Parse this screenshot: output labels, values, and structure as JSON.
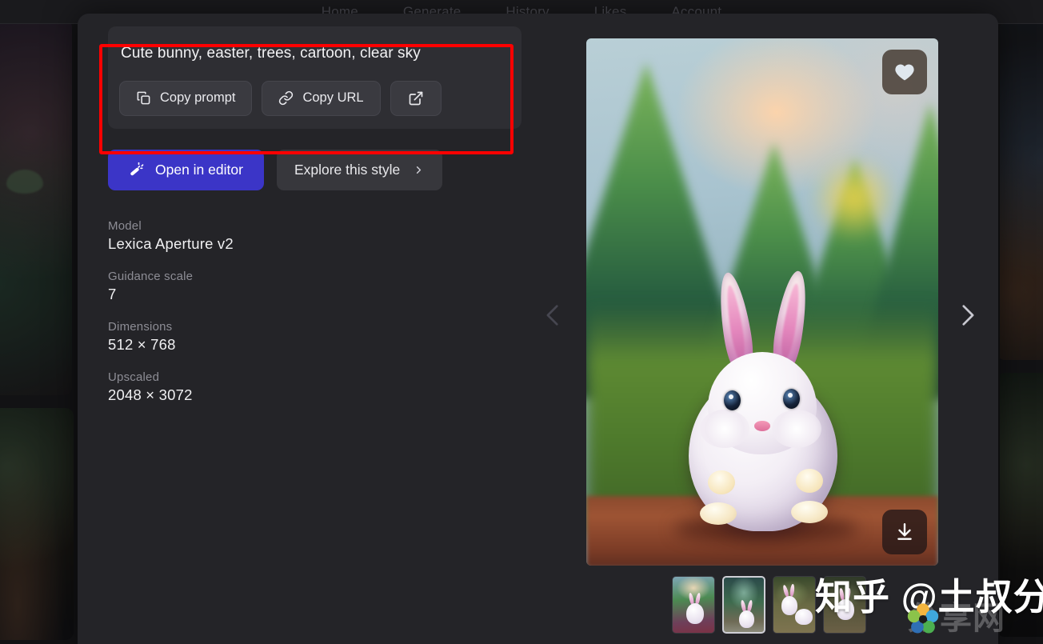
{
  "nav": {
    "items": [
      {
        "label": "Home"
      },
      {
        "label": "Generate"
      },
      {
        "label": "History"
      },
      {
        "label": "Likes"
      },
      {
        "label": "Account"
      }
    ]
  },
  "prompt": {
    "text": "Cute bunny, easter, trees, cartoon, clear sky",
    "copy_prompt_label": "Copy prompt",
    "copy_url_label": "Copy URL",
    "copy_icon": "copy-icon",
    "link_icon": "link-icon",
    "external_icon": "external-link-icon"
  },
  "actions": {
    "open_in_editor_label": "Open in editor",
    "open_in_editor_icon": "magic-wand-icon",
    "open_in_editor_color": "#3b35c7",
    "explore_style_label": "Explore this style",
    "explore_style_icon": "chevron-right-icon"
  },
  "metadata": [
    {
      "label": "Model",
      "value": "Lexica Aperture v2"
    },
    {
      "label": "Guidance scale",
      "value": "7"
    },
    {
      "label": "Dimensions",
      "value": "512 × 768"
    },
    {
      "label": "Upscaled",
      "value": "2048 × 3072"
    }
  ],
  "image_panel": {
    "like_icon": "heart-icon",
    "download_icon": "download-icon",
    "prev_icon": "chevron-left-icon",
    "next_icon": "chevron-right-icon"
  },
  "thumbnails": [
    {
      "name": "thumbnail-1",
      "selected": false
    },
    {
      "name": "thumbnail-2",
      "selected": true
    },
    {
      "name": "thumbnail-3",
      "selected": false
    },
    {
      "name": "thumbnail-4",
      "selected": false
    }
  ],
  "annotation": {
    "color": "#fe0000"
  },
  "watermark": {
    "text": "知乎 @土叔分享",
    "ghost_text": "分享网"
  }
}
